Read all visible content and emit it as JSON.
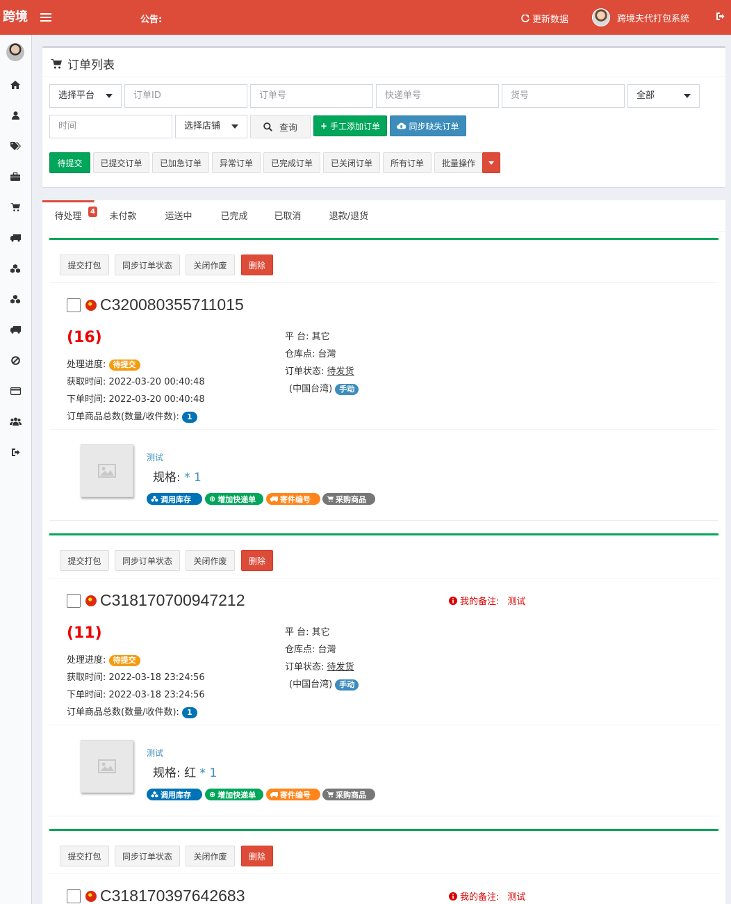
{
  "header": {
    "logo": "跨境",
    "notice_label": "公告:",
    "refresh_label": "更新数据",
    "user_name": "跨境夫代打包系统"
  },
  "sidebar": {
    "icons": [
      "home-icon",
      "user-icon",
      "tags-icon",
      "briefcase-icon",
      "cart-icon",
      "truck-icon",
      "cubes-icon",
      "cubes-icon",
      "truck-icon",
      "ban-icon",
      "credit-card-icon",
      "users-icon",
      "sign-out-icon"
    ]
  },
  "filters": {
    "title": "订单列表",
    "platform_select": "选择平台",
    "order_id_placeholder": "订单ID",
    "order_no_placeholder": "订单号",
    "express_no_placeholder": "快递单号",
    "goods_no_placeholder": "货号",
    "status_select": "全部",
    "time_placeholder": "时间",
    "shop_select": "选择店铺",
    "search_label": "查询",
    "manual_add_label": "手工添加订单",
    "sync_missing_label": "同步缺失订单",
    "status_buttons": [
      "待提交",
      "已提交订单",
      "已加急订单",
      "异常订单",
      "已完成订单",
      "已关闭订单",
      "所有订单",
      "批量操作"
    ]
  },
  "tabs": {
    "items": [
      "待处理",
      "未付款",
      "运送中",
      "已完成",
      "已取消",
      "退款/退货"
    ],
    "pending_badge": "4"
  },
  "order_actions": {
    "submit": "提交打包",
    "sync": "同步订单状态",
    "close": "关闭作废",
    "delete": "删除"
  },
  "labels": {
    "progress": "处理进度:",
    "fetch_time": "获取时间:",
    "order_time": "下单时间:",
    "goods_total": "订单商品总数(数量/收件数):",
    "platform": "平 台:",
    "warehouse": "仓库点:",
    "order_status": "订单状态:",
    "remark": "我的备注:",
    "spec": "规格:"
  },
  "goods_tags": {
    "stock": "调用库存",
    "express": "增加快递单",
    "parcel": "寄件编号",
    "purchase": "采购商品"
  },
  "orders": [
    {
      "id": "C320080355711015",
      "count": "(16)",
      "progress": "待提交",
      "fetch_time": "2022-03-20 00:40:48",
      "order_time": "2022-03-20 00:40:48",
      "goods_total": "1",
      "platform": "其它",
      "warehouse": "台灣",
      "status": "待发货",
      "region": "(中国台湾)",
      "mode": "手动",
      "remark": "",
      "goods_name": "测试",
      "spec_value": "",
      "qty": "* 1"
    },
    {
      "id": "C318170700947212",
      "count": "(11)",
      "progress": "待提交",
      "fetch_time": "2022-03-18 23:24:56",
      "order_time": "2022-03-18 23:24:56",
      "goods_total": "1",
      "platform": "其它",
      "warehouse": "台灣",
      "status": "待发货",
      "region": "(中国台湾)",
      "mode": "手动",
      "remark": "测试",
      "goods_name": "测试",
      "spec_value": "红",
      "qty": "* 1"
    },
    {
      "id": "C318170397642683",
      "remark": "测试"
    }
  ],
  "colors": {
    "header": "#dd4b39",
    "success": "#00a65a",
    "primary": "#3c8dbc",
    "danger": "#dd4b39"
  }
}
